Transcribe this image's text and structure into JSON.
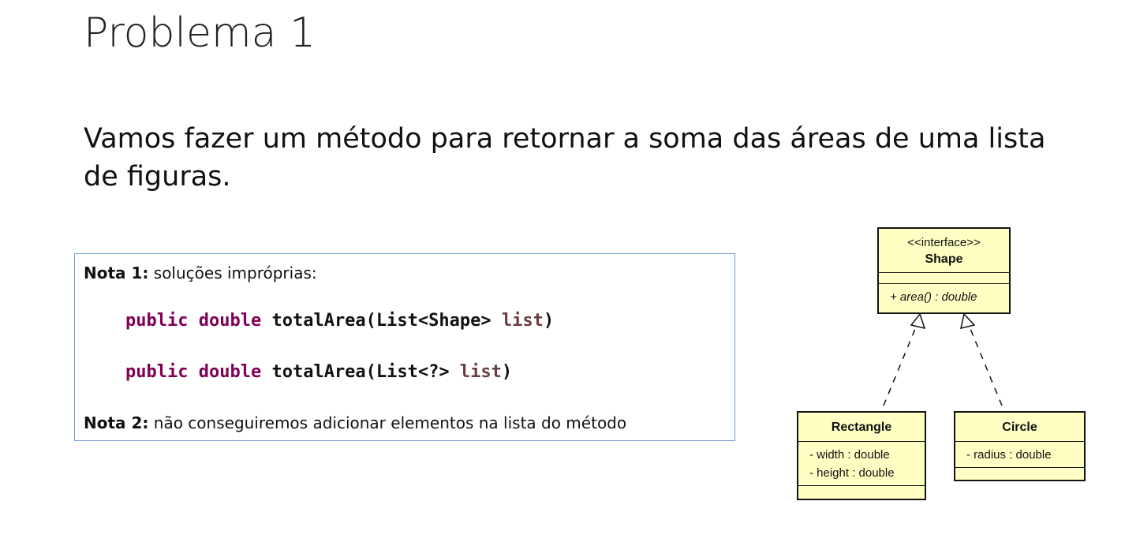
{
  "slide": {
    "title": "Problema 1",
    "subtitle": "Vamos fazer um método para retornar a soma das áreas de uma lista de figuras."
  },
  "note": {
    "note1_label": "Nota 1:",
    "note1_text": " soluções impróprias:",
    "code1": {
      "kw1": "public",
      "kw2": "double",
      "method": "totalArea(List<Shape>",
      "param": "list",
      "close": ")"
    },
    "code2": {
      "kw1": "public",
      "kw2": "double",
      "method": "totalArea(List<?>",
      "param": "list",
      "close": ")"
    },
    "note2_label": "Nota 2:",
    "note2_text": " não conseguiremos adicionar elementos na lista do método"
  },
  "uml": {
    "shape": {
      "stereotype": "<<interface>>",
      "name": "Shape",
      "method": "+ area() : double"
    },
    "rectangle": {
      "name": "Rectangle",
      "attr1": "- width : double",
      "attr2": "- height : double"
    },
    "circle": {
      "name": "Circle",
      "attr1": "- radius : double"
    }
  }
}
